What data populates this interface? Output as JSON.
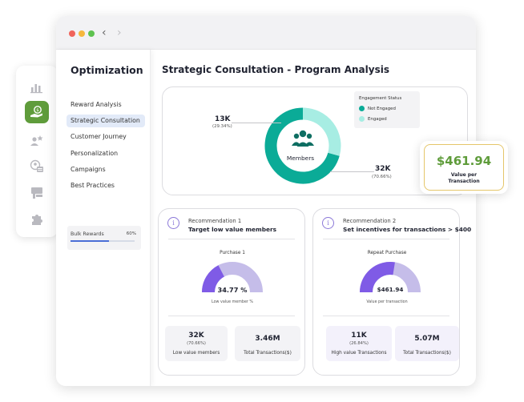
{
  "window": {
    "back_glyph": "‹",
    "forward_glyph": "›"
  },
  "colors": {
    "accent_green": "#5f9c3b",
    "teal": "#0bab97",
    "light_teal": "#a7ede3",
    "purple": "#7f5be6",
    "light_purple": "#c5bde9",
    "gold_border": "#e5c66a"
  },
  "rail": {
    "icons": [
      "bar-chart-icon",
      "hand-money-icon",
      "user-star-icon",
      "user-card-icon",
      "megaphone-icon",
      "puzzle-icon"
    ],
    "active_index": 1
  },
  "sidebar": {
    "title": "Optimization",
    "items": [
      "Reward Analysis",
      "Strategic Consultation",
      "Customer Journey",
      "Personalization",
      "Campaigns",
      "Best Practices"
    ],
    "active_index": 1,
    "bulk": {
      "label": "Bulk Rewards",
      "percent_text": "60%",
      "progress": 0.6
    }
  },
  "main": {
    "title": "Strategic Consultation - Program Analysis"
  },
  "engagement": {
    "legend_title": "Engagement Status",
    "legend": [
      {
        "label": "Not Engaged",
        "color": "#0bab97"
      },
      {
        "label": "Engaged",
        "color": "#a7ede3"
      }
    ],
    "center_label": "Members",
    "engaged": {
      "value": "13K",
      "pct": "(29.34%)",
      "fraction": 0.2934
    },
    "not_engaged": {
      "value": "32K",
      "pct": "(70.66%)",
      "fraction": 0.7066
    }
  },
  "value_card": {
    "amount": "$461.94",
    "label_line1": "Value per",
    "label_line2": "Transaction"
  },
  "recommendations": [
    {
      "sub": "Recommendation 1",
      "headline": "Target low value members",
      "gauge_title": "Purchase 1",
      "gauge_center": "34.77 %",
      "gauge_caption": "Low value member %",
      "gauge_fraction": 0.3477,
      "stats": [
        {
          "value": "32K",
          "pct": "(70.66%)",
          "label": "Low value members"
        },
        {
          "value": "3.46M",
          "pct": "",
          "label": "Total Transactions($)"
        }
      ]
    },
    {
      "sub": "Recommendation 2",
      "headline": "Set incentives for transactions > $400",
      "gauge_title": "Repeat Purchase",
      "gauge_center": "$461.94",
      "gauge_caption": "Value per transaction",
      "gauge_fraction": 0.55,
      "stats": [
        {
          "value": "11K",
          "pct": "(26.84%)",
          "label": "High value Transactions"
        },
        {
          "value": "5.07M",
          "pct": "",
          "label": "Total Transactions($)"
        }
      ]
    }
  ]
}
